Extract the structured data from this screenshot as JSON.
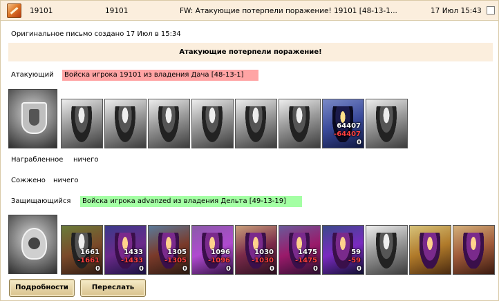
{
  "header": {
    "from": "19101",
    "to": "19101",
    "subject": "FW: Атакующие потерпели поражение! 19101 [48-13-1...",
    "date": "17 Июл 15:43"
  },
  "original_note": "Оригинальное письмо создано 17 Июл в 15:34",
  "result_banner": "Атакующие потерпели поражение!",
  "attacker": {
    "label": "Атакующий",
    "army": "Войска игрока 19101 из владения Дача [48-13-1]",
    "units": [
      {
        "icon": "black-knight-unit-icon"
      },
      {
        "icon": "swordsman-unit-icon"
      },
      {
        "icon": "cavalry-unit-icon"
      },
      {
        "icon": "griffin-rider-unit-icon"
      },
      {
        "icon": "archer-unit-icon"
      },
      {
        "icon": "hooded-monk-unit-icon"
      },
      {
        "icon": "hero-unit-icon",
        "count": "64407",
        "lost": "-64407",
        "left": "0"
      },
      {
        "icon": "reaper-unit-icon"
      }
    ]
  },
  "loot": {
    "label": "Награбленное",
    "value": "ничего"
  },
  "burned": {
    "label": "Сожжено",
    "value": "ничего"
  },
  "defender": {
    "label": "Защищающийся",
    "army": "Войска игрока advanzed из владения Дельта [49-13-19]",
    "units": [
      {
        "icon": "troll-unit-icon",
        "count": "1661",
        "lost": "-1661",
        "left": "0"
      },
      {
        "icon": "assassin-unit-icon",
        "count": "1433",
        "lost": "-1433",
        "left": "0"
      },
      {
        "icon": "beast-rider-unit-icon",
        "count": "1305",
        "lost": "-1305",
        "left": "0"
      },
      {
        "icon": "harpy-unit-icon",
        "count": "1096",
        "lost": "-1096",
        "left": "0"
      },
      {
        "icon": "dark-archer-unit-icon",
        "count": "1030",
        "lost": "-1030",
        "left": "0"
      },
      {
        "icon": "sorceress-unit-icon",
        "count": "1475",
        "lost": "-1475",
        "left": "0"
      },
      {
        "icon": "lich-unit-icon",
        "count": "59",
        "lost": "-59",
        "left": "0"
      },
      {
        "icon": "spider-unit-icon"
      },
      {
        "icon": "orb-creature-unit-icon"
      },
      {
        "icon": "crystal-creature-unit-icon"
      }
    ]
  },
  "buttons": {
    "details": "Подробности",
    "forward": "Переслать"
  }
}
